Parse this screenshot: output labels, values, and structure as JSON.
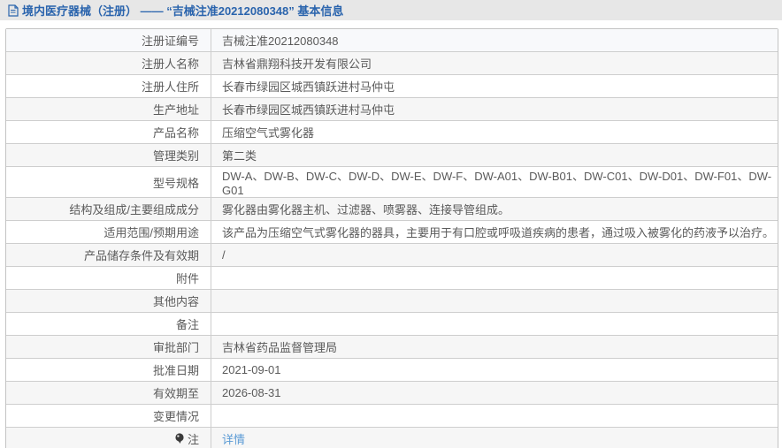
{
  "header": {
    "title": "境内医疗器械（注册） —— “吉械注准20212080348” 基本信息"
  },
  "table": {
    "rows": [
      {
        "label": "注册证编号",
        "value": "吉械注准20212080348"
      },
      {
        "label": "注册人名称",
        "value": "吉林省鼎翔科技开发有限公司"
      },
      {
        "label": "注册人住所",
        "value": "长春市绿园区城西镇跃进村马仲屯"
      },
      {
        "label": "生产地址",
        "value": "长春市绿园区城西镇跃进村马仲屯"
      },
      {
        "label": "产品名称",
        "value": "压缩空气式雾化器"
      },
      {
        "label": "管理类别",
        "value": "第二类"
      },
      {
        "label": "型号规格",
        "value": "DW-A、DW-B、DW-C、DW-D、DW-E、DW-F、DW-A01、DW-B01、DW-C01、DW-D01、DW-F01、DW-G01"
      },
      {
        "label": "结构及组成/主要组成成分",
        "value": "雾化器由雾化器主机、过滤器、喷雾器、连接导管组成。"
      },
      {
        "label": "适用范围/预期用途",
        "value": "该产品为压缩空气式雾化器的器具，主要用于有口腔或呼吸道疾病的患者，通过吸入被雾化的药液予以治疗。"
      },
      {
        "label": "产品储存条件及有效期",
        "value": "/"
      },
      {
        "label": "附件",
        "value": ""
      },
      {
        "label": "其他内容",
        "value": ""
      },
      {
        "label": "备注",
        "value": ""
      },
      {
        "label": "审批部门",
        "value": "吉林省药品监督管理局"
      },
      {
        "label": "批准日期",
        "value": "2021-09-01"
      },
      {
        "label": "有效期至",
        "value": "2026-08-31"
      },
      {
        "label": "变更情况",
        "value": ""
      },
      {
        "label": "注",
        "label_icon": "note-icon",
        "value": "详情",
        "value_is_link": true
      }
    ]
  },
  "colors": {
    "title_text": "#2a64ad",
    "title_bar_bg": "#e7e7e7",
    "link": "#5b9bd5",
    "row_first_bg": "#f8f9fb",
    "row_alt_bg": "#f6f6f6",
    "border": "#cecece",
    "cell_text": "#5a5a5a"
  }
}
